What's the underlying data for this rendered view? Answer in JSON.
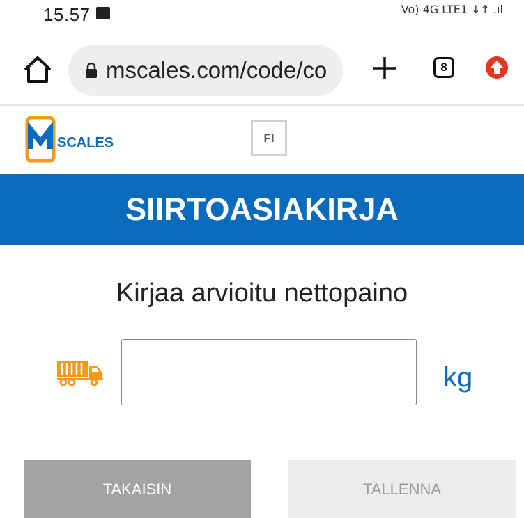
{
  "status_bar": {
    "time": "15.57",
    "indicators": "Vo) 4G LTE1 ↓↑ .ıl"
  },
  "browser": {
    "url": "mscales.com/code/co",
    "tab_count": "8",
    "icons": [
      "home-icon",
      "lock-icon",
      "plus-icon",
      "tabs-icon",
      "upload-icon"
    ]
  },
  "site": {
    "logo_text": "SCALES",
    "language_button": "FI"
  },
  "page": {
    "title": "SIIRTOASIAKIRJA",
    "prompt": "Kirjaa arvioitu nettopaino",
    "weight_value": "",
    "unit": "kg"
  },
  "buttons": {
    "back": "TAKAISIN",
    "save": "TALLENNA"
  },
  "colors": {
    "brand_blue": "#0a6bbd",
    "accent_orange": "#f39a1d",
    "back_button": "#a3a3a3",
    "save_button_disabled": "#ececec"
  }
}
